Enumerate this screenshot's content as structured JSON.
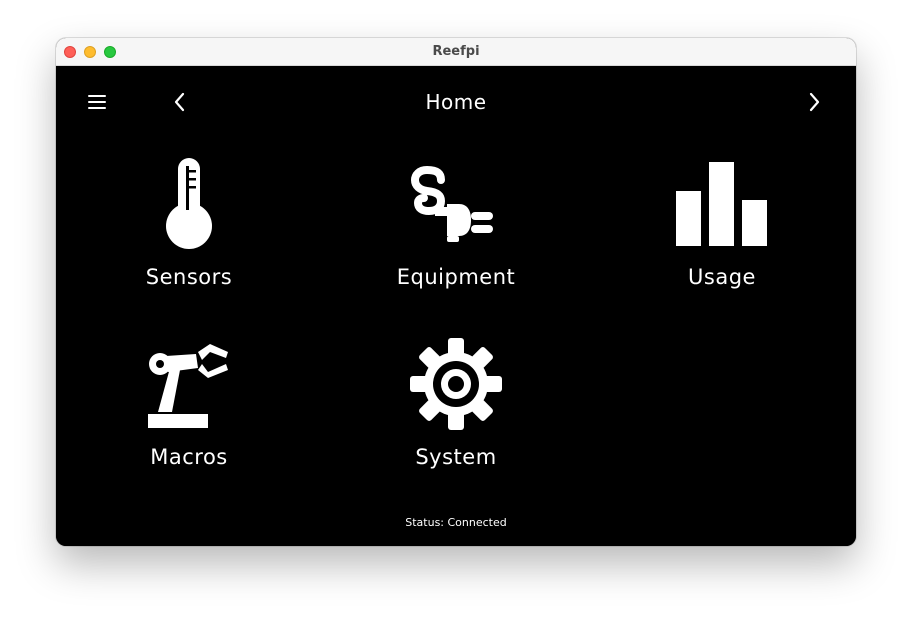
{
  "window": {
    "title": "Reefpi"
  },
  "header": {
    "title": "Home",
    "menu_icon": "hamburger-menu-icon",
    "prev_icon": "chevron-left-icon",
    "next_icon": "chevron-right-icon"
  },
  "tiles": [
    {
      "label": "Sensors",
      "icon": "thermometer-icon"
    },
    {
      "label": "Equipment",
      "icon": "plug-icon"
    },
    {
      "label": "Usage",
      "icon": "bar-chart-icon"
    },
    {
      "label": "Macros",
      "icon": "robot-arm-icon"
    },
    {
      "label": "System",
      "icon": "gear-icon"
    }
  ],
  "status": {
    "text": "Status: Connected"
  },
  "colors": {
    "background": "#000000",
    "foreground": "#ffffff",
    "titlebar": "#f6f6f6"
  }
}
